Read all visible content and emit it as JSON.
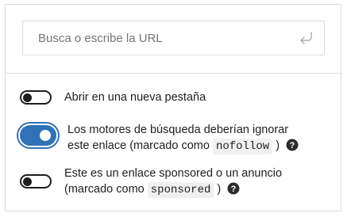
{
  "search": {
    "placeholder": "Busca o escribe la URL",
    "submit_icon": "enter-arrow-icon"
  },
  "settings": {
    "new_tab": {
      "label": "Abrir en una nueva pestaña",
      "checked": false
    },
    "nofollow": {
      "label_line1": "Los motores de búsqueda deberían ignorar",
      "label_before": "este enlace (marcado como",
      "code": "nofollow",
      "label_after": ")",
      "help_icon": "help-question-icon",
      "checked": true
    },
    "sponsored": {
      "label_line1": "Este es un enlace sponsored o un anuncio",
      "label_before": "(marcado como",
      "code": "sponsored",
      "label_after": ")",
      "help_icon": "help-question-icon",
      "checked": false
    }
  },
  "colors": {
    "accent": "#3071b8",
    "border": "#dcdcde",
    "text": "#1e1e1e",
    "placeholder": "#757575"
  }
}
